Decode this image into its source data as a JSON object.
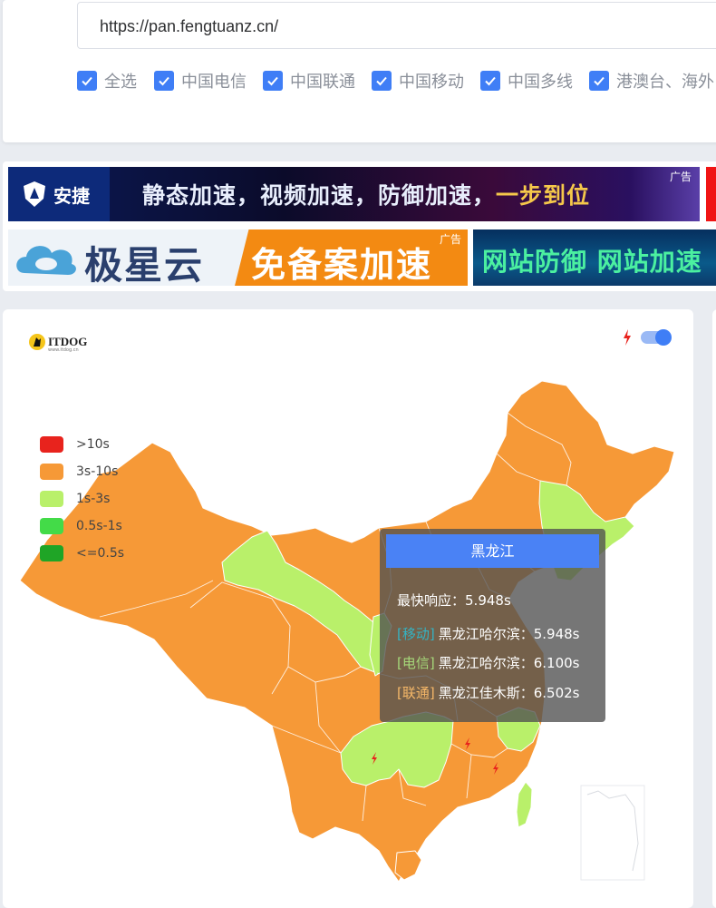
{
  "url_input": {
    "value": "https://pan.fengtuanz.cn/"
  },
  "isp_filters": [
    {
      "label": "全选",
      "checked": true
    },
    {
      "label": "中国电信",
      "checked": true
    },
    {
      "label": "中国联通",
      "checked": true
    },
    {
      "label": "中国移动",
      "checked": true
    },
    {
      "label": "中国多线",
      "checked": true
    },
    {
      "label": "港澳台、海外",
      "checked": true
    }
  ],
  "ads": {
    "tag": "广告",
    "banner1": {
      "brand": "安捷",
      "text_main": "静态加速，视频加速，防御加速，",
      "text_highlight": "一步到位"
    },
    "banner2": {
      "brand": "极星云",
      "text": "免备案加速"
    },
    "banner3": {
      "text": "网站防御 网站加速"
    }
  },
  "map_panel": {
    "logo_text": "ITDOG",
    "logo_sub": "www.itdog.cn",
    "icon": "lightning-icon",
    "toggle_on": true
  },
  "legend": [
    {
      "label": ">10s",
      "color": "#e8231d"
    },
    {
      "label": "3s-10s",
      "color": "#f69937"
    },
    {
      "label": "1s-3s",
      "color": "#b9f06a"
    },
    {
      "label": "0.5s-1s",
      "color": "#43db48"
    },
    {
      "label": "<=0.5s",
      "color": "#1fa526"
    }
  ],
  "tooltip": {
    "title": "黑龙江",
    "fastest_label": "最快响应：",
    "fastest_value": "5.948s",
    "rows": [
      {
        "isp": "[移动]",
        "isp_color": "#34b3c3",
        "node": "黑龙江哈尔滨：",
        "value": "5.948s"
      },
      {
        "isp": "[电信]",
        "isp_color": "#a6d97a",
        "node": "黑龙江哈尔滨：",
        "value": "6.100s"
      },
      {
        "isp": "[联通]",
        "isp_color": "#f6b868",
        "node": "黑龙江佳木斯：",
        "value": "6.502s"
      }
    ]
  },
  "colors": {
    "slow": "#f69937",
    "medium": "#b9f06a",
    "accent": "#3f7ef6"
  }
}
